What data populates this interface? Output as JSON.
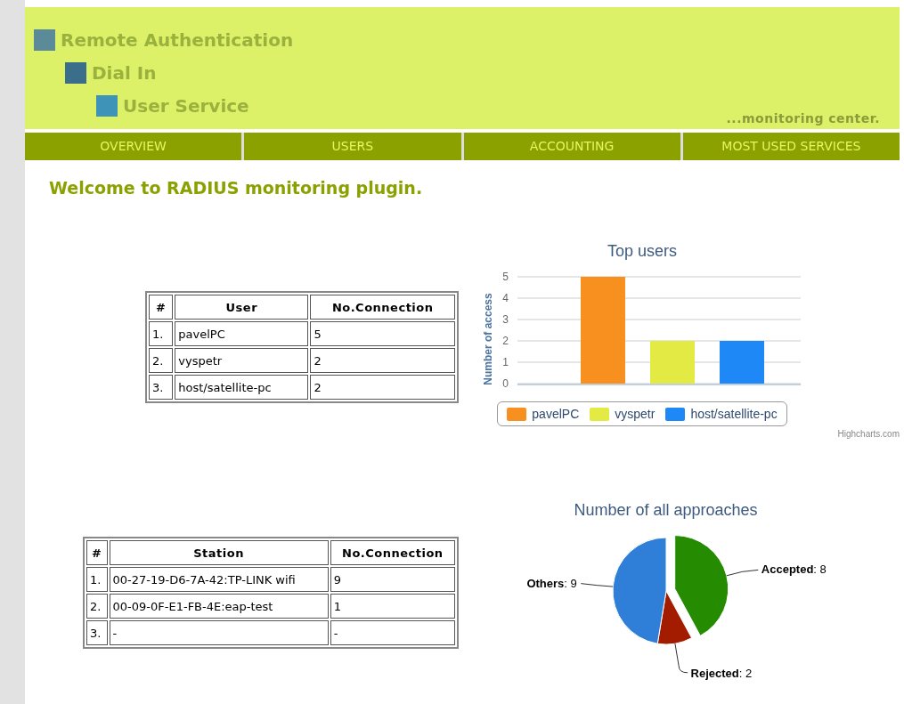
{
  "header": {
    "titles": [
      "Remote Authentication",
      "Dial In",
      "User Service"
    ],
    "tagline": "...monitoring center."
  },
  "nav": [
    {
      "label": "OVERVIEW",
      "selected": false
    },
    {
      "label": "USERS",
      "selected": false
    },
    {
      "label": "ACCOUNTING",
      "selected": false
    },
    {
      "label": "MOST USED SERVICES",
      "selected": false
    }
  ],
  "welcome": "Welcome to RADIUS monitoring plugin.",
  "users_table": {
    "columns": [
      "#",
      "User",
      "No.Connection"
    ],
    "rows": [
      [
        "1.",
        "pavelPC",
        "5"
      ],
      [
        "2.",
        "vyspetr",
        "2"
      ],
      [
        "3.",
        "host/satellite-pc",
        "2"
      ]
    ]
  },
  "top_users_chart": {
    "chart_data": {
      "type": "bar",
      "grid": true,
      "title": "Top users",
      "ylabel": "Number of access",
      "ylim": [
        0,
        5
      ],
      "yticks": [
        0,
        1,
        2,
        3,
        4,
        5
      ],
      "series": [
        {
          "name": "pavelPC",
          "color": "#f7901e",
          "values": [
            5
          ]
        },
        {
          "name": "vyspetr",
          "color": "#e4ea44",
          "values": [
            2
          ]
        },
        {
          "name": "host/satellite-pc",
          "color": "#1e88f7",
          "values": [
            2
          ]
        }
      ]
    },
    "credit": "Highcharts.com"
  },
  "stations_table": {
    "columns": [
      "#",
      "Station",
      "No.Connection"
    ],
    "rows": [
      [
        "1.",
        "00-27-19-D6-7A-42:TP-LINK wifi",
        "9"
      ],
      [
        "2.",
        "00-09-0F-E1-FB-4E:eap-test",
        "1"
      ],
      [
        "3.",
        "-",
        "-"
      ]
    ]
  },
  "approaches_chart": {
    "chart_data": {
      "type": "pie",
      "title": "Number of all approaches",
      "series": [
        {
          "values": [
            42.1,
            10.5,
            47.4
          ]
        }
      ],
      "value_labels": [
        "**Accepted**: 8",
        "**Rejected**: 2",
        "**Others**: 9"
      ]
    }
  }
}
